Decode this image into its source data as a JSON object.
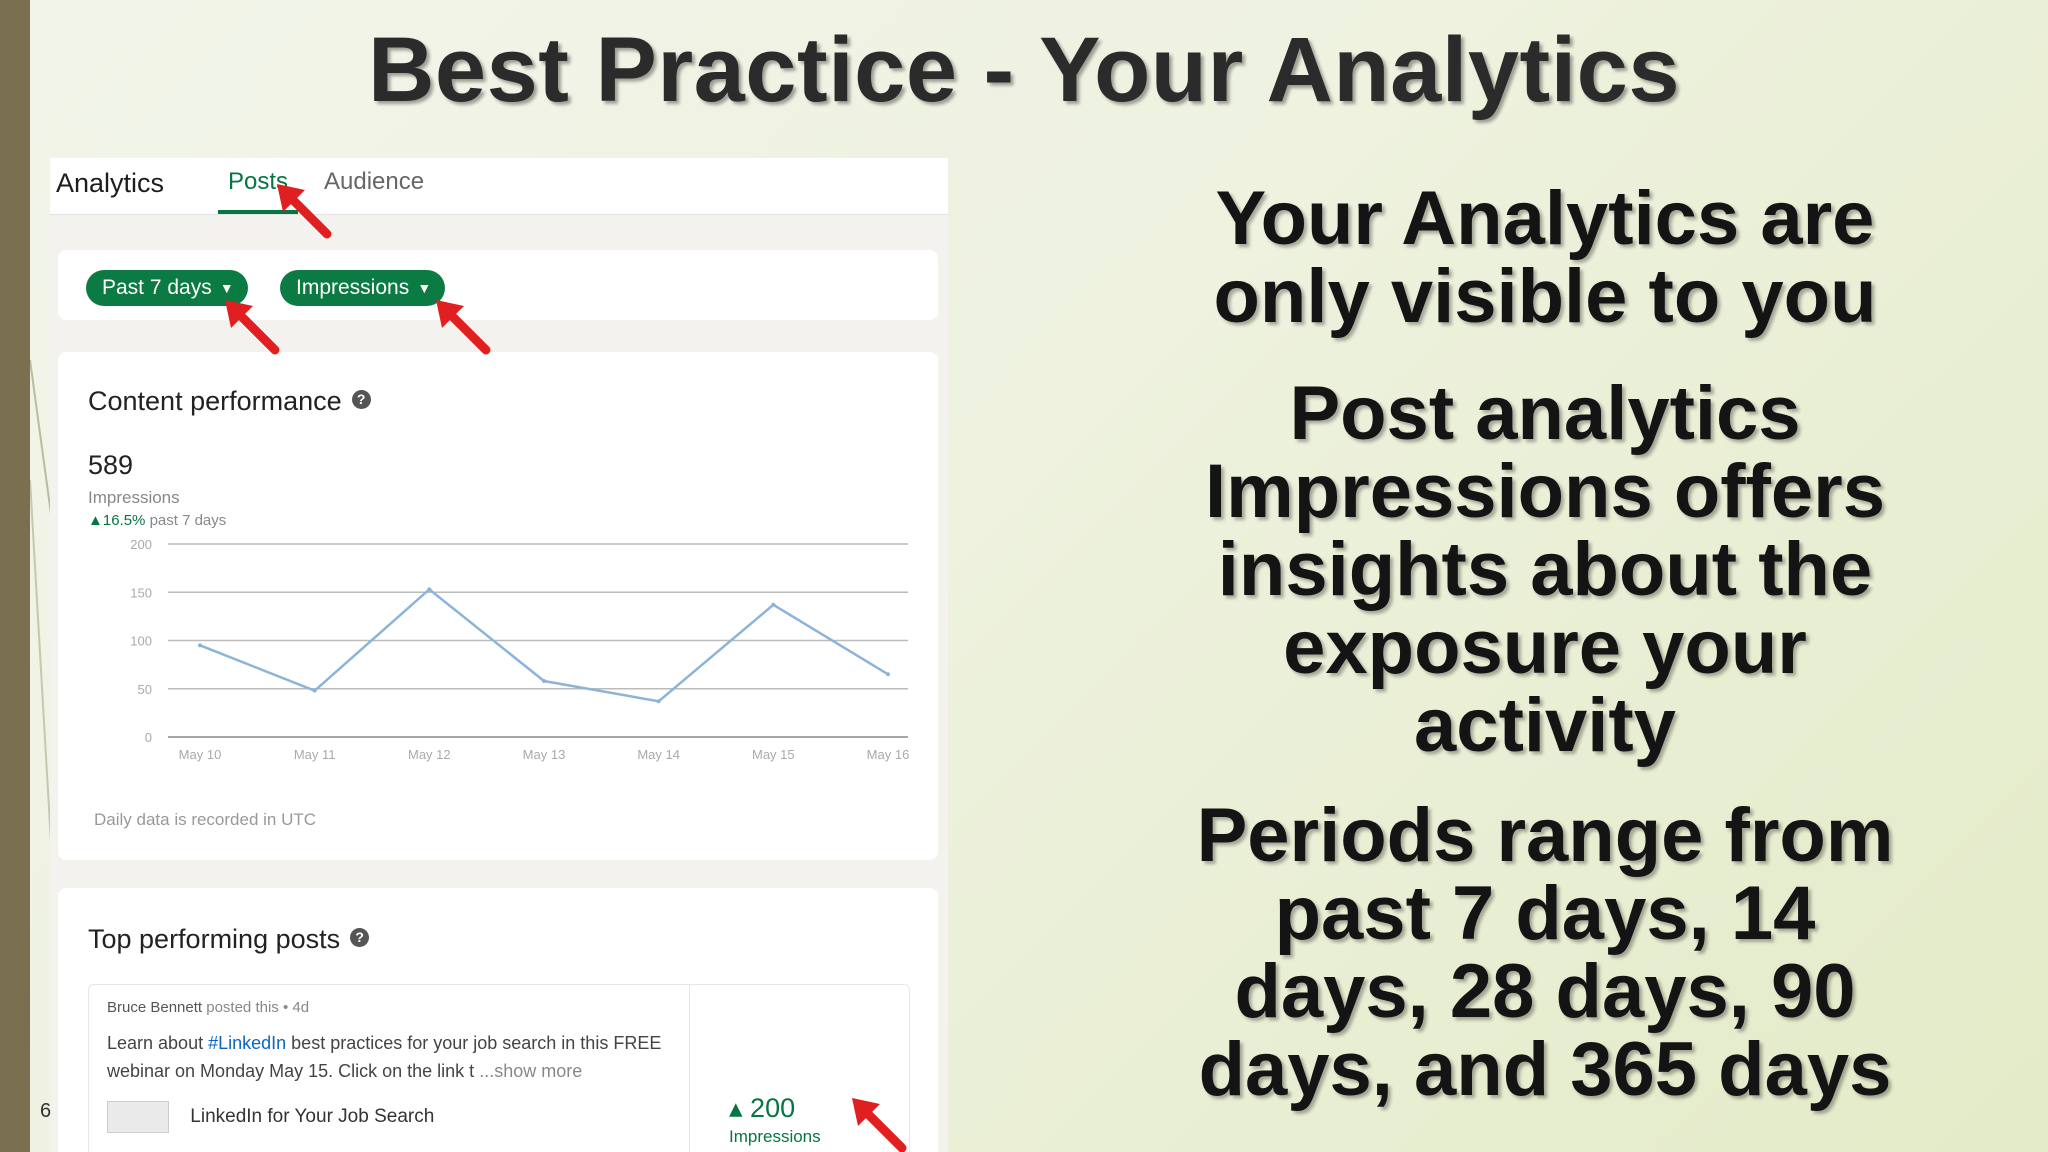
{
  "slide": {
    "title": "Best Practice - Your Analytics",
    "page_number": "6",
    "accent_color": "#7a6f4e"
  },
  "screenshot": {
    "tabs": {
      "analytics": "Analytics",
      "posts": "Posts",
      "audience": "Audience"
    },
    "filters": {
      "period": "Past 7 days",
      "metric": "Impressions"
    },
    "performance": {
      "title": "Content performance",
      "total": "589",
      "total_label": "Impressions",
      "change": "▲16.5%",
      "change_label": "past 7 days",
      "footnote": "Daily data is recorded in UTC"
    },
    "top_posts": {
      "title": "Top performing posts",
      "author": "Bruce Bennett",
      "meta": "posted this • 4d",
      "text_before": "Learn about ",
      "hashtag": "#LinkedIn",
      "text_after": " best practices for your job search in this FREE webinar on Monday May 15. Click on the link t",
      "show_more": "...show more",
      "link_title": "LinkedIn for Your Job Search",
      "impressions": "▴ 200",
      "impressions_label": "Impressions"
    }
  },
  "chart_data": {
    "type": "line",
    "categories": [
      "May 10",
      "May 11",
      "May 12",
      "May 13",
      "May 14",
      "May 15",
      "May 16"
    ],
    "values": [
      95,
      48,
      153,
      58,
      37,
      137,
      65
    ],
    "ylim": [
      0,
      200
    ],
    "yticks": [
      0,
      50,
      100,
      150,
      200
    ],
    "grid": true,
    "line_color": "#8cb4d8"
  },
  "right_panel": {
    "block1": [
      "Your Analytics are",
      "only visible to you"
    ],
    "block2": [
      "Post analytics",
      "Impressions offers",
      "insights about the",
      "exposure your",
      "activity"
    ],
    "block3": [
      "Periods range from",
      "past 7 days, 14",
      "days, 28 days, 90",
      "days, and 365 days"
    ]
  }
}
